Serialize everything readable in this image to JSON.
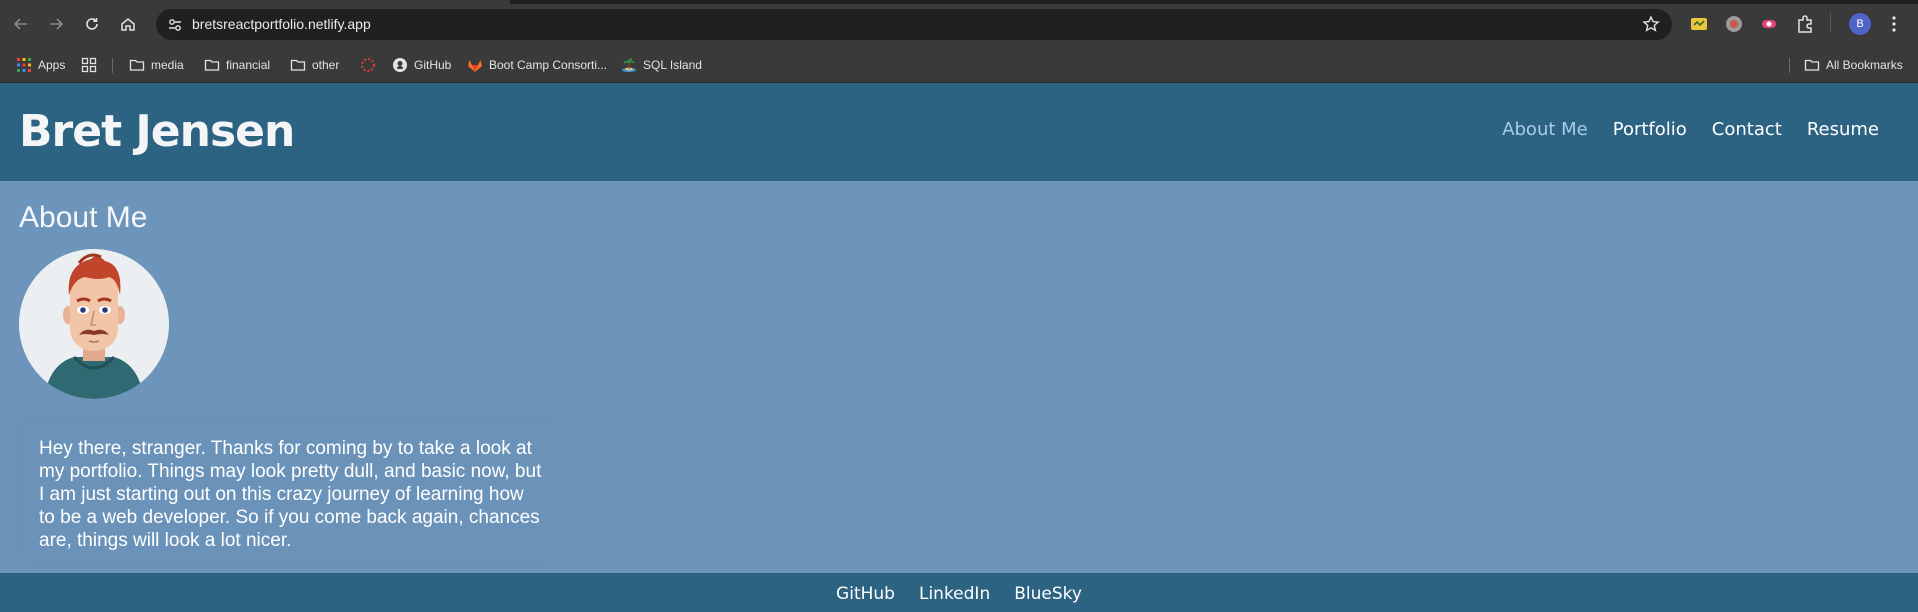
{
  "browser": {
    "url": "bretsreactportfolio.netlify.app",
    "profile_initial": "B",
    "bookmarks": [
      {
        "label": "Apps",
        "icon": "apps-grid-icon"
      },
      {
        "label": "",
        "icon": "tab-groups-icon"
      },
      {
        "label": "media",
        "icon": "folder-icon"
      },
      {
        "label": "financial",
        "icon": "folder-icon"
      },
      {
        "label": "other",
        "icon": "folder-icon"
      },
      {
        "label": "",
        "icon": "red-dotted-circle-icon"
      },
      {
        "label": "GitHub",
        "icon": "github-icon"
      },
      {
        "label": "Boot Camp Consorti...",
        "icon": "gitlab-icon"
      },
      {
        "label": "SQL Island",
        "icon": "island-icon"
      }
    ],
    "all_bookmarks_label": "All Bookmarks"
  },
  "header": {
    "title": "Bret Jensen",
    "nav": [
      {
        "label": "About Me",
        "active": true
      },
      {
        "label": "Portfolio",
        "active": false
      },
      {
        "label": "Contact",
        "active": false
      },
      {
        "label": "Resume",
        "active": false
      }
    ]
  },
  "main": {
    "section_title": "About Me",
    "avatar_icon": "cartoon-avatar-icon",
    "bio": "Hey there, stranger. Thanks for coming by to take a look at my portfolio. Things may look pretty dull, and basic now, but I am just starting out on this crazy journey of learning how to be a web developer. So if you come back again, chances are, things will look a lot nicer."
  },
  "footer": {
    "links": [
      "GitHub",
      "LinkedIn",
      "BlueSky"
    ]
  },
  "colors": {
    "header_bg": "#2c6282",
    "page_bg": "#6d95bb",
    "nav_active": "#a9cde6"
  }
}
